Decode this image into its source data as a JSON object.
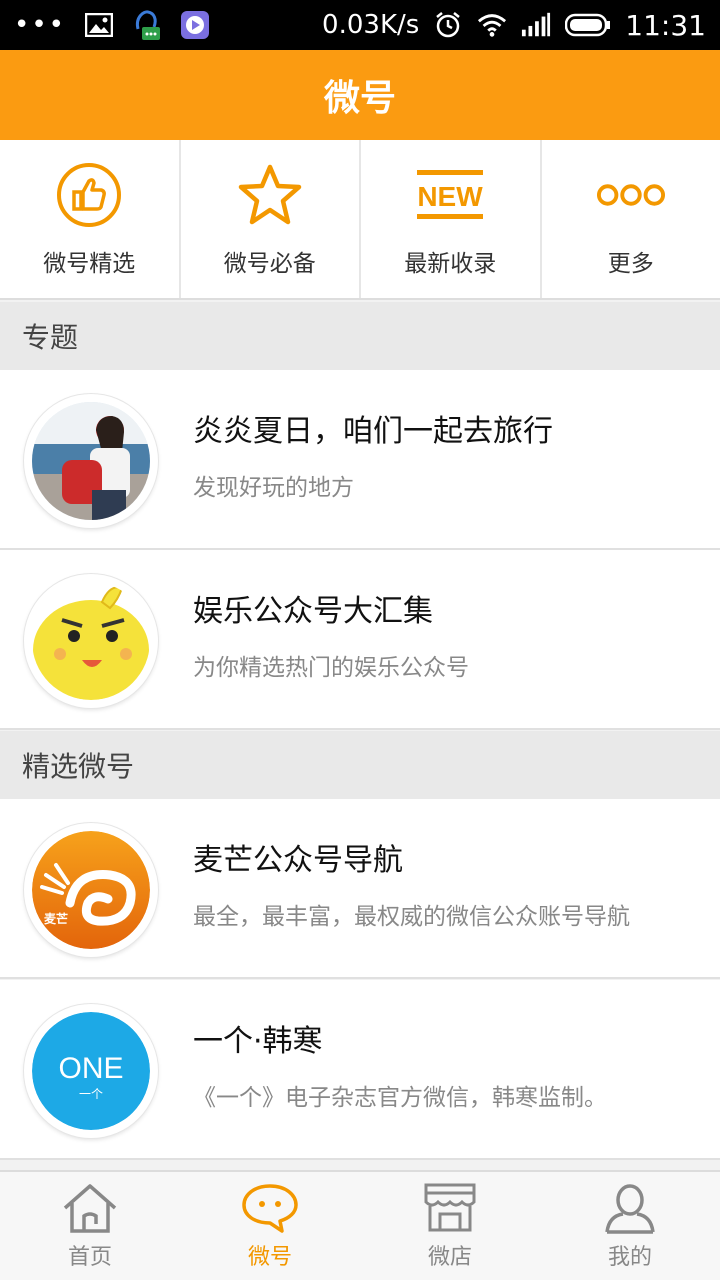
{
  "status_bar": {
    "network_speed": "0.03K/s",
    "time": "11:31",
    "left_icons": [
      "dots-icon",
      "image-icon",
      "qq-icon",
      "video-icon"
    ],
    "right_icons": [
      "alarm-icon",
      "wifi-icon",
      "signal-icon",
      "battery-icon"
    ]
  },
  "app_bar": {
    "title": "微号"
  },
  "categories": [
    {
      "label": "微号精选",
      "icon": "thumbs-up-icon"
    },
    {
      "label": "微号必备",
      "icon": "star-icon"
    },
    {
      "label": "最新收录",
      "icon": "new-icon",
      "icon_text": "NEW"
    },
    {
      "label": "更多",
      "icon": "more-icon"
    }
  ],
  "sections": {
    "topics": "专题",
    "featured": "精选微号"
  },
  "topics": [
    {
      "title": "炎炎夏日，咱们一起去旅行",
      "subtitle": "发现好玩的地方",
      "avatar": "travel-photo-avatar"
    },
    {
      "title": "娱乐公众号大汇集",
      "subtitle": "为你精选热门的娱乐公众号",
      "avatar": "bunny-cartoon-avatar"
    }
  ],
  "featured": [
    {
      "title": "麦芒公众号导航",
      "subtitle": "最全，最丰富，最权威的微信公众账号导航",
      "avatar": "maimang-logo-avatar",
      "logo_text": "麦芒"
    },
    {
      "title": "一个·韩寒",
      "subtitle": "《一个》电子杂志官方微信，韩寒监制。",
      "avatar": "one-logo-avatar",
      "logo_text": "ONE",
      "logo_sub": "一个"
    }
  ],
  "bottom_nav": [
    {
      "label": "首页",
      "icon": "home-icon",
      "active": false
    },
    {
      "label": "微号",
      "icon": "chat-bubble-icon",
      "active": true
    },
    {
      "label": "微店",
      "icon": "shop-icon",
      "active": false
    },
    {
      "label": "我的",
      "icon": "user-icon",
      "active": false
    }
  ],
  "colors": {
    "accent": "#fb9b11",
    "active_nav": "#f39800"
  }
}
